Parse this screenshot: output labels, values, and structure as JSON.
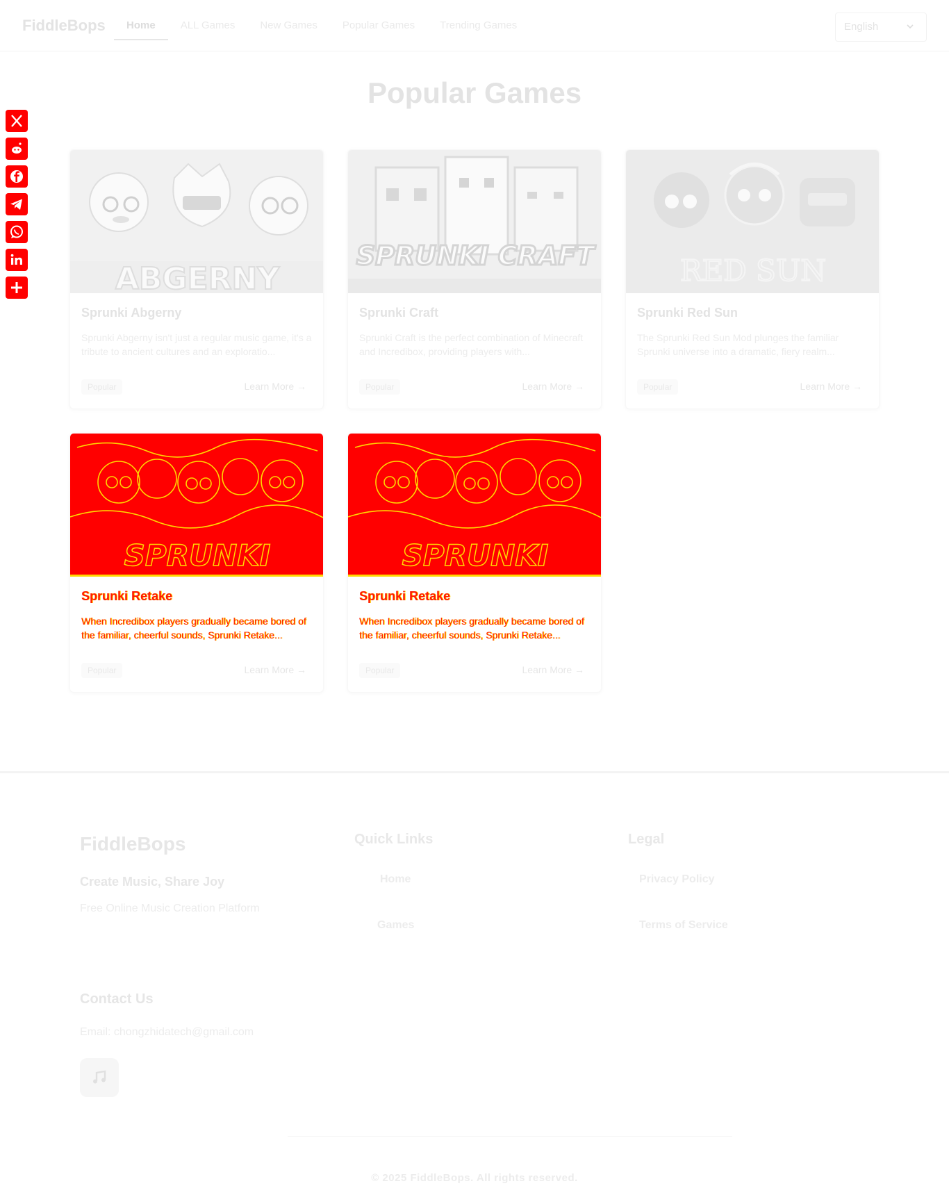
{
  "header": {
    "brand": "FiddleBops",
    "nav": [
      "Home",
      "ALL Games",
      "New Games",
      "Popular Games",
      "Trending Games"
    ],
    "language": "English"
  },
  "social": [
    {
      "icon": "x-icon"
    },
    {
      "icon": "reddit-icon"
    },
    {
      "icon": "facebook-icon"
    },
    {
      "icon": "telegram-icon"
    },
    {
      "icon": "whatsapp-icon"
    },
    {
      "icon": "linkedin-icon"
    },
    {
      "icon": "share-plus-icon"
    }
  ],
  "colors": {
    "share_red": "#ff0000",
    "hot_yellow": "#ffd800"
  },
  "main": {
    "title": "Popular Games",
    "cards": [
      {
        "title": "Sprunki Abgerny",
        "desc": "Sprunki Abgerny isn't just a regular music game, it's a tribute to ancient cultures and an exploratio...",
        "tag": "Popular",
        "link": "Learn More →",
        "thumb_text": "ABGERNY"
      },
      {
        "title": "Sprunki Craft",
        "desc": "Sprunki Craft is the perfect combination of Minecraft and Incredibox, providing players with...",
        "tag": "Popular",
        "link": "Learn More →",
        "thumb_text": "SPRUNKI CRAFT"
      },
      {
        "title": "Sprunki Red Sun",
        "desc": "The Sprunki Red Sun Mod plunges the familiar Sprunki universe into a dramatic, fiery realm...",
        "tag": "Popular",
        "link": "Learn More →",
        "thumb_text": "RED SUN"
      },
      {
        "title": "Sprunki Retake",
        "desc": "When Incredibox players gradually became bored of the familiar, cheerful sounds, Sprunki Retake...",
        "tag": "Popular",
        "link": "Learn More →",
        "thumb_text": "SPRUNKI"
      },
      {
        "title": "Sprunki Retake",
        "desc": "When Incredibox players gradually became bored of the familiar, cheerful sounds, Sprunki Retake...",
        "tag": "Popular",
        "link": "Learn More →",
        "thumb_text": "SPRUNKI"
      }
    ]
  },
  "footer": {
    "brand": "FiddleBops",
    "tagline": "Create Music, Share Joy",
    "subtitle": "Free Online Music Creation Platform",
    "contact_heading": "Contact Us",
    "email": "Email: chongzhidatech@gmail.com",
    "quick_links_heading": "Quick Links",
    "quick_links": [
      "Home",
      "Games"
    ],
    "legal_heading": "Legal",
    "legal_links": [
      "Privacy Policy",
      "Terms of Service"
    ],
    "copyright": "© 2025 FiddleBops. All rights reserved."
  }
}
